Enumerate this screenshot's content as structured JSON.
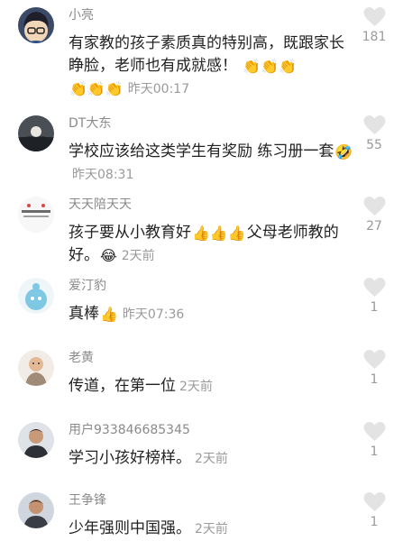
{
  "colors": {
    "username": "#8a8a8a",
    "text": "#222222",
    "muted": "#9a9a9a",
    "heart": "#e3e3e3"
  },
  "comments": [
    {
      "username": "小亮",
      "avatar": "detective-anime-avatar",
      "segments": [
        {
          "t": "text",
          "v": "有家教的孩子素质真的特别高，既跟家长睁脸，老师也有成就感！"
        },
        {
          "t": "emoji",
          "v": "👏👏👏"
        },
        {
          "t": "emoji",
          "v": "👏👏👏"
        },
        {
          "t": "time",
          "v": "昨天00:17"
        }
      ],
      "likes": "181"
    },
    {
      "username": "DT大东",
      "avatar": "sunset-avatar",
      "segments": [
        {
          "t": "text",
          "v": "学校应该给这类学生有奖励 练习册一套"
        },
        {
          "t": "emoji",
          "v": "🤣"
        },
        {
          "t": "time",
          "v": "昨天08:31"
        }
      ],
      "likes": "55"
    },
    {
      "username": "天天陪天天",
      "avatar": "text-logo-avatar",
      "segments": [
        {
          "t": "text",
          "v": "孩子要从小教育好"
        },
        {
          "t": "emoji",
          "v": "👍👍👍"
        },
        {
          "t": "text",
          "v": "父母老师教的好。"
        },
        {
          "t": "emoji",
          "v": "😂"
        },
        {
          "t": "time",
          "v": "2天前"
        }
      ],
      "likes": "27"
    },
    {
      "username": "爱汀豹",
      "avatar": "blue-cartoon-avatar",
      "segments": [
        {
          "t": "text",
          "v": "真棒"
        },
        {
          "t": "emoji",
          "v": "👍"
        },
        {
          "t": "time",
          "v": "昨天07:36"
        }
      ],
      "likes": "1"
    },
    {
      "username": "老黄",
      "avatar": "baby-photo-avatar",
      "segments": [
        {
          "t": "text",
          "v": "传道，在第一位"
        },
        {
          "t": "time",
          "v": "2天前"
        }
      ],
      "likes": "1"
    },
    {
      "username": "用户933846685345",
      "avatar": "man-portrait-avatar",
      "segments": [
        {
          "t": "text",
          "v": "学习小孩好榜样。"
        },
        {
          "t": "time",
          "v": "2天前"
        }
      ],
      "likes": "1"
    },
    {
      "username": "王争锋",
      "avatar": "man-portrait-avatar-2",
      "segments": [
        {
          "t": "text",
          "v": "少年强则中国强。"
        },
        {
          "t": "time",
          "v": "2天前"
        }
      ],
      "likes": "1"
    }
  ]
}
